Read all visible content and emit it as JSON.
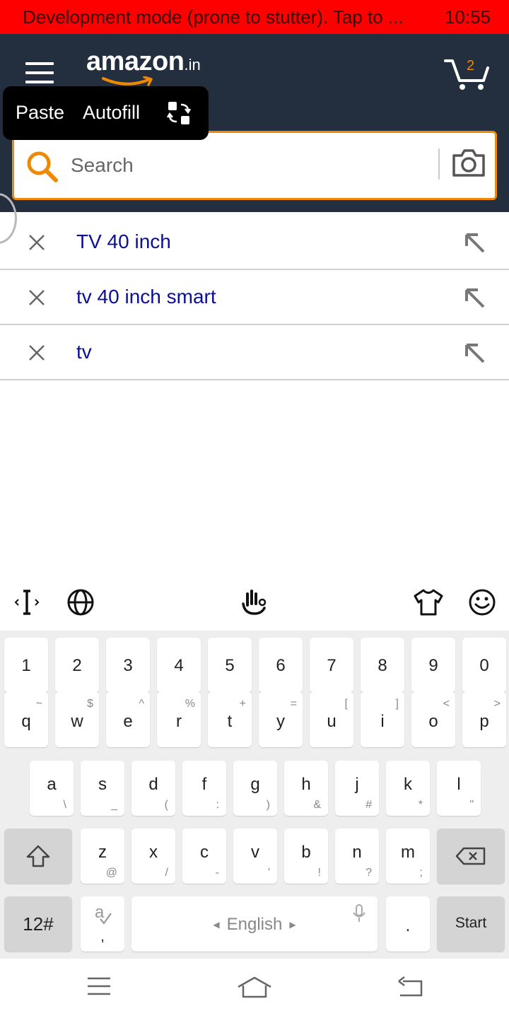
{
  "status_bar": {
    "dev_message": "Development mode (prone to stutter). Tap to ...",
    "time": "10:55"
  },
  "header": {
    "logo_text": "amazon",
    "logo_tld": ".in",
    "cart_count": "2",
    "brand_color": "#f08804",
    "bg_color": "#232f3e"
  },
  "clipboard_popup": {
    "paste": "Paste",
    "autofill": "Autofill",
    "icon": "swap-icon"
  },
  "search": {
    "placeholder": "Search",
    "value": ""
  },
  "suggestions": [
    {
      "text": "TV 40 inch"
    },
    {
      "text": "tv 40 inch smart"
    },
    {
      "text": "tv"
    }
  ],
  "keyboard": {
    "toolbar_icons": [
      "text-cursor-icon",
      "globe-icon",
      "gesture-hand-icon",
      "theme-shirt-icon",
      "emoji-icon"
    ],
    "number_row": [
      "1",
      "2",
      "3",
      "4",
      "5",
      "6",
      "7",
      "8",
      "9",
      "0"
    ],
    "row1": [
      {
        "main": "q",
        "sub": "~"
      },
      {
        "main": "w",
        "sub": "$"
      },
      {
        "main": "e",
        "sub": "^"
      },
      {
        "main": "r",
        "sub": "%"
      },
      {
        "main": "t",
        "sub": "+"
      },
      {
        "main": "y",
        "sub": "="
      },
      {
        "main": "u",
        "sub": "["
      },
      {
        "main": "i",
        "sub": "]"
      },
      {
        "main": "o",
        "sub": "<"
      },
      {
        "main": "p",
        "sub": ">"
      }
    ],
    "row2": [
      {
        "main": "a",
        "sub": "\\"
      },
      {
        "main": "s",
        "sub": "_"
      },
      {
        "main": "d",
        "sub": "("
      },
      {
        "main": "f",
        "sub": ":"
      },
      {
        "main": "g",
        "sub": ")"
      },
      {
        "main": "h",
        "sub": "&"
      },
      {
        "main": "j",
        "sub": "#"
      },
      {
        "main": "k",
        "sub": "*"
      },
      {
        "main": "l",
        "sub": "\""
      }
    ],
    "row3": [
      {
        "main": "z",
        "sub": "@"
      },
      {
        "main": "x",
        "sub": "/"
      },
      {
        "main": "c",
        "sub": "-"
      },
      {
        "main": "v",
        "sub": "'"
      },
      {
        "main": "b",
        "sub": "!"
      },
      {
        "main": "n",
        "sub": "?"
      },
      {
        "main": "m",
        "sub": ";"
      }
    ],
    "symbols_key": "12#",
    "comma_key": ",",
    "space_label": "English",
    "period_key": ".",
    "enter_key": "Start"
  }
}
